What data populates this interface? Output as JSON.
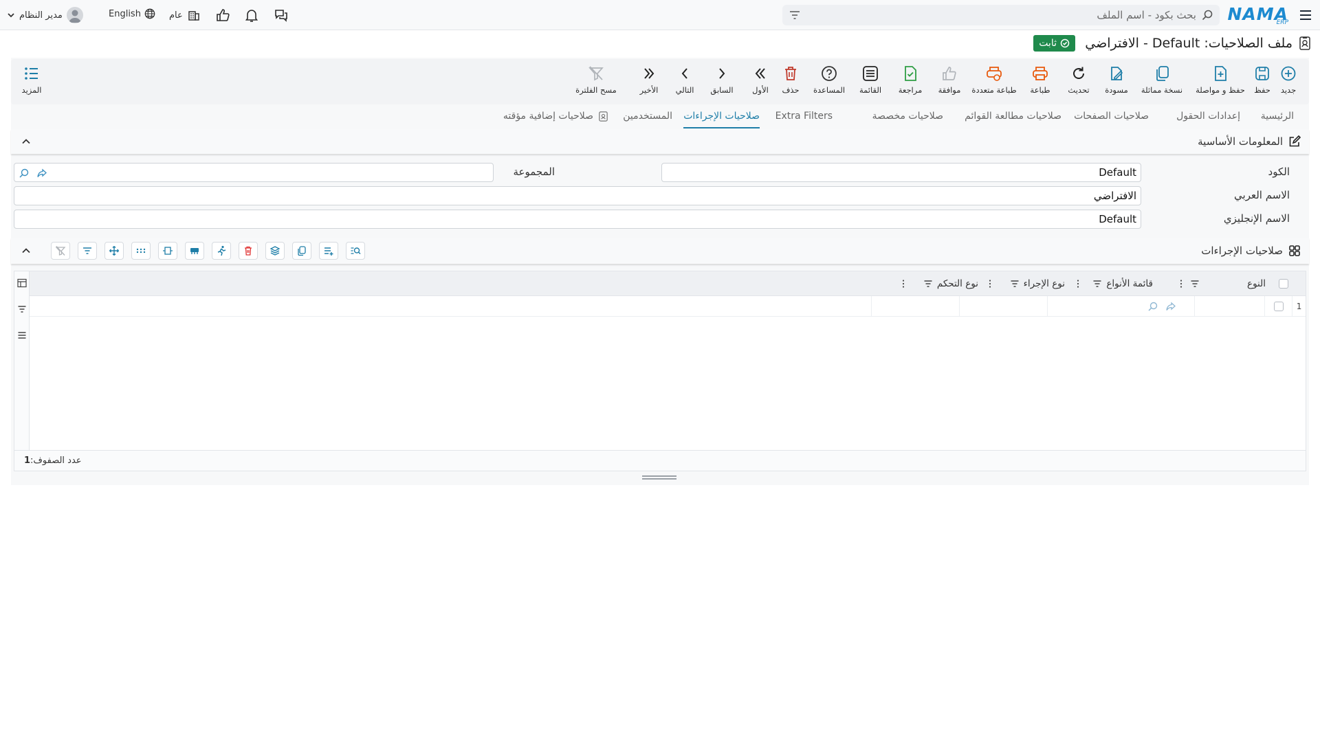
{
  "app": {
    "logo_text": "NAMA",
    "logo_sub": "ERP"
  },
  "search": {
    "placeholder": "بحث بكود - اسم الملف"
  },
  "topbar": {
    "user_name": "مدير النظام",
    "language": "English",
    "branch": "عام"
  },
  "title": {
    "text": "ملف الصلاحيات: Default - الافتراضي",
    "status_badge": "ثابت"
  },
  "toolbar": {
    "buttons": [
      {
        "label": "جديد",
        "icon": "plus-circle-icon",
        "color": "#1e7ea8"
      },
      {
        "label": "حفظ",
        "icon": "save-icon",
        "color": "#1e7ea8"
      },
      {
        "label": "حفظ و مواصلة",
        "icon": "save-continue-icon",
        "color": "#1e7ea8"
      },
      {
        "label": "نسخة مماثلة",
        "icon": "copy-icon",
        "color": "#1e7ea8"
      },
      {
        "label": "مسودة",
        "icon": "draft-icon",
        "color": "#1e7ea8"
      },
      {
        "label": "تحديث",
        "icon": "refresh-icon",
        "color": "#222222"
      },
      {
        "label": "طباعة",
        "icon": "print-icon",
        "color": "#e8590c"
      },
      {
        "label": "طباعة متعددة",
        "icon": "multi-print-icon",
        "color": "#e8590c"
      },
      {
        "label": "موافقة",
        "icon": "thumbs-up-icon",
        "color": "#b0b4b9"
      },
      {
        "label": "مراجعة",
        "icon": "review-icon",
        "color": "#2f9e44"
      },
      {
        "label": "القائمة",
        "icon": "list-icon",
        "color": "#222222"
      },
      {
        "label": "المساعدة",
        "icon": "help-icon",
        "color": "#333333"
      },
      {
        "label": "حذف",
        "icon": "trash-icon",
        "color": "#c0392b"
      },
      {
        "label": "الأول",
        "icon": "first-icon",
        "color": "#222222"
      },
      {
        "label": "السابق",
        "icon": "prev-icon",
        "color": "#222222"
      },
      {
        "label": "التالي",
        "icon": "next-icon",
        "color": "#222222"
      },
      {
        "label": "الأخير",
        "icon": "last-icon",
        "color": "#222222"
      },
      {
        "label": "مسح الفلترة",
        "icon": "clear-filter-icon",
        "color": "#b0b4b9"
      }
    ],
    "more_label": "المزيد"
  },
  "tabs": [
    {
      "label": "الرئيسية",
      "active": false
    },
    {
      "label": "إعدادات الحقول",
      "active": false
    },
    {
      "label": "صلاحيات الصفحات",
      "active": false
    },
    {
      "label": "صلاحيات مطالعة القوائم",
      "active": false
    },
    {
      "label": "صلاحيات مخصصة",
      "active": false
    },
    {
      "label": "Extra Filters",
      "active": false
    },
    {
      "label": "صلاحيات الإجراءات",
      "active": true
    },
    {
      "label": "المستخدمين",
      "active": false
    },
    {
      "label": "صلاحيات إضافية مؤقته",
      "active": false
    }
  ],
  "basic_info": {
    "title": "المعلومات الأساسية",
    "code_label": "الكود",
    "code_value": "Default",
    "group_label": "المجموعة",
    "group_value": "",
    "arabic_name_label": "الاسم العربي",
    "arabic_name_value": "الافتراضي",
    "english_name_label": "الاسم الإنجليزي",
    "english_name_value": "Default"
  },
  "actions_section": {
    "title": "صلاحيات الإجراءات",
    "columns": [
      "النوع",
      "قائمة الأنواع",
      "نوع الإجراء",
      "نوع التحكم"
    ],
    "rows": [
      {
        "index": "1"
      }
    ],
    "row_count_label": "عدد الصفوف:",
    "row_count_value": "1"
  },
  "colors": {
    "accent": "#1e7ea8",
    "badge": "#1f8a4c",
    "danger": "#c0392b"
  }
}
